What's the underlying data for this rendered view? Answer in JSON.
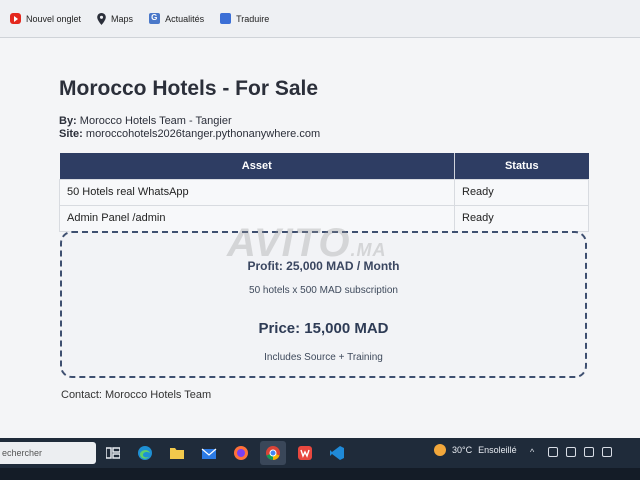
{
  "bookmarks": [
    {
      "label": "Nouvel onglet",
      "icon": "youtube-icon"
    },
    {
      "label": "Maps",
      "icon": "maps-pin-icon"
    },
    {
      "label": "Actualités",
      "icon": "news-icon"
    },
    {
      "label": "Traduire",
      "icon": "translate-icon"
    }
  ],
  "page": {
    "title": "Morocco Hotels - For Sale",
    "by_label": "By:",
    "by_value": "Morocco Hotels Team - Tangier",
    "site_label": "Site:",
    "site_value": "moroccohotels2026tanger.pythonanywhere.com"
  },
  "table": {
    "headers": [
      "Asset",
      "Status"
    ],
    "rows": [
      [
        "50 Hotels real WhatsApp",
        "Ready"
      ],
      [
        "Admin Panel /admin",
        "Ready"
      ]
    ]
  },
  "offer": {
    "profit": "Profit: 25,000 MAD / Month",
    "subscription": "50 hotels x 500 MAD subscription",
    "price": "Price: 15,000 MAD",
    "includes": "Includes Source + Training"
  },
  "watermark": {
    "main": "AVITO",
    "suffix": ".MA"
  },
  "contact": "Contact: Morocco Hotels Team",
  "taskbar": {
    "search_text": "echercher",
    "weather": "30°C",
    "weather_desc": "Ensoleillé"
  },
  "colors": {
    "header_bg": "#2e3d63",
    "offer_border": "#3e4f70",
    "taskbar_bg": "#1f2b3a"
  }
}
